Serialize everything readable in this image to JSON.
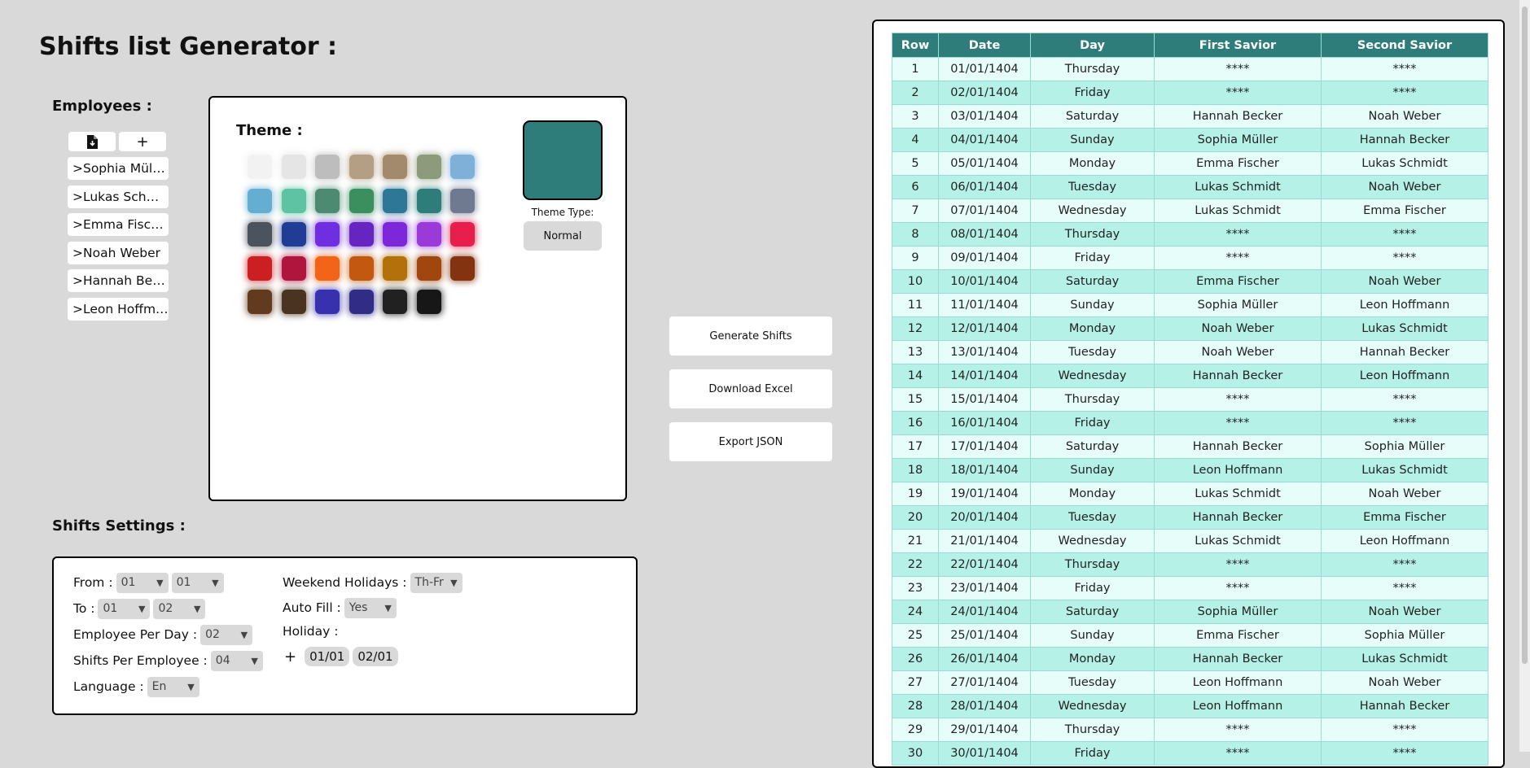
{
  "app": {
    "title": "Shifts list Generator :"
  },
  "employees": {
    "section_label": "Employees :",
    "import_icon": "file-import-icon",
    "add_label": "+",
    "items": [
      ">Sophia Müller",
      ">Lukas Schmidt",
      ">Emma Fischer",
      ">Noah Weber",
      ">Hannah Becker",
      ">Leon Hoffmann"
    ]
  },
  "theme": {
    "title": "Theme :",
    "selected_color": "#2e7d7a",
    "type_label": "Theme Type:",
    "type_value": "Normal",
    "swatches": [
      "#f2f2f2",
      "#e5e5e5",
      "#bdbdbd",
      "#b49f85",
      "#a38a6c",
      "#8d9b7c",
      "#7eb0d8",
      "#64afd1",
      "#5ec3a2",
      "#4c8a72",
      "#3b8e5e",
      "#2f7796",
      "#2e7d7a",
      "#6f7a90",
      "#4b535f",
      "#213c95",
      "#6f2ee0",
      "#6425c1",
      "#7d27da",
      "#9b3ad8",
      "#e81f4c",
      "#cc1f22",
      "#b0163d",
      "#f26417",
      "#c35810",
      "#b3700b",
      "#a2460f",
      "#83330f",
      "#623a1e",
      "#4b3322",
      "#3731b0",
      "#312d86",
      "#212121",
      "#171717"
    ]
  },
  "actions": {
    "generate_label": "Generate Shifts",
    "download_label": "Download Excel",
    "export_label": "Export JSON"
  },
  "settings": {
    "section_label": "Shifts Settings :",
    "from_label": "From :",
    "from_day": "01",
    "from_month": "01",
    "to_label": "To :",
    "to_day": "01",
    "to_month": "02",
    "per_day_label": "Employee Per Day :",
    "per_day_value": "02",
    "per_employee_label": "Shifts Per Employee :",
    "per_employee_value": "04",
    "language_label": "Language :",
    "language_value": "En",
    "weekend_label": "Weekend Holidays :",
    "weekend_value": "Th-Fr",
    "autofill_label": "Auto Fill :",
    "autofill_value": "Yes",
    "holiday_label": "Holiday :",
    "holiday_add": "+",
    "holidays": [
      "01/01",
      "02/01"
    ]
  },
  "table": {
    "columns": [
      "Row",
      "Date",
      "Day",
      "First Savior",
      "Second Savior"
    ],
    "rows": [
      [
        "1",
        "01/01/1404",
        "Thursday",
        "****",
        "****"
      ],
      [
        "2",
        "02/01/1404",
        "Friday",
        "****",
        "****"
      ],
      [
        "3",
        "03/01/1404",
        "Saturday",
        "Hannah Becker",
        "Noah Weber"
      ],
      [
        "4",
        "04/01/1404",
        "Sunday",
        "Sophia Müller",
        "Hannah Becker"
      ],
      [
        "5",
        "05/01/1404",
        "Monday",
        "Emma Fischer",
        "Lukas Schmidt"
      ],
      [
        "6",
        "06/01/1404",
        "Tuesday",
        "Lukas Schmidt",
        "Noah Weber"
      ],
      [
        "7",
        "07/01/1404",
        "Wednesday",
        "Lukas Schmidt",
        "Emma Fischer"
      ],
      [
        "8",
        "08/01/1404",
        "Thursday",
        "****",
        "****"
      ],
      [
        "9",
        "09/01/1404",
        "Friday",
        "****",
        "****"
      ],
      [
        "10",
        "10/01/1404",
        "Saturday",
        "Emma Fischer",
        "Noah Weber"
      ],
      [
        "11",
        "11/01/1404",
        "Sunday",
        "Sophia Müller",
        "Leon Hoffmann"
      ],
      [
        "12",
        "12/01/1404",
        "Monday",
        "Noah Weber",
        "Lukas Schmidt"
      ],
      [
        "13",
        "13/01/1404",
        "Tuesday",
        "Noah Weber",
        "Hannah Becker"
      ],
      [
        "14",
        "14/01/1404",
        "Wednesday",
        "Hannah Becker",
        "Leon Hoffmann"
      ],
      [
        "15",
        "15/01/1404",
        "Thursday",
        "****",
        "****"
      ],
      [
        "16",
        "16/01/1404",
        "Friday",
        "****",
        "****"
      ],
      [
        "17",
        "17/01/1404",
        "Saturday",
        "Hannah Becker",
        "Sophia Müller"
      ],
      [
        "18",
        "18/01/1404",
        "Sunday",
        "Leon Hoffmann",
        "Lukas Schmidt"
      ],
      [
        "19",
        "19/01/1404",
        "Monday",
        "Lukas Schmidt",
        "Noah Weber"
      ],
      [
        "20",
        "20/01/1404",
        "Tuesday",
        "Hannah Becker",
        "Emma Fischer"
      ],
      [
        "21",
        "21/01/1404",
        "Wednesday",
        "Lukas Schmidt",
        "Leon Hoffmann"
      ],
      [
        "22",
        "22/01/1404",
        "Thursday",
        "****",
        "****"
      ],
      [
        "23",
        "23/01/1404",
        "Friday",
        "****",
        "****"
      ],
      [
        "24",
        "24/01/1404",
        "Saturday",
        "Sophia Müller",
        "Noah Weber"
      ],
      [
        "25",
        "25/01/1404",
        "Sunday",
        "Emma Fischer",
        "Sophia Müller"
      ],
      [
        "26",
        "26/01/1404",
        "Monday",
        "Hannah Becker",
        "Lukas Schmidt"
      ],
      [
        "27",
        "27/01/1404",
        "Tuesday",
        "Leon Hoffmann",
        "Noah Weber"
      ],
      [
        "28",
        "28/01/1404",
        "Wednesday",
        "Leon Hoffmann",
        "Hannah Becker"
      ],
      [
        "29",
        "29/01/1404",
        "Thursday",
        "****",
        "****"
      ],
      [
        "30",
        "30/01/1404",
        "Friday",
        "****",
        "****"
      ]
    ]
  }
}
